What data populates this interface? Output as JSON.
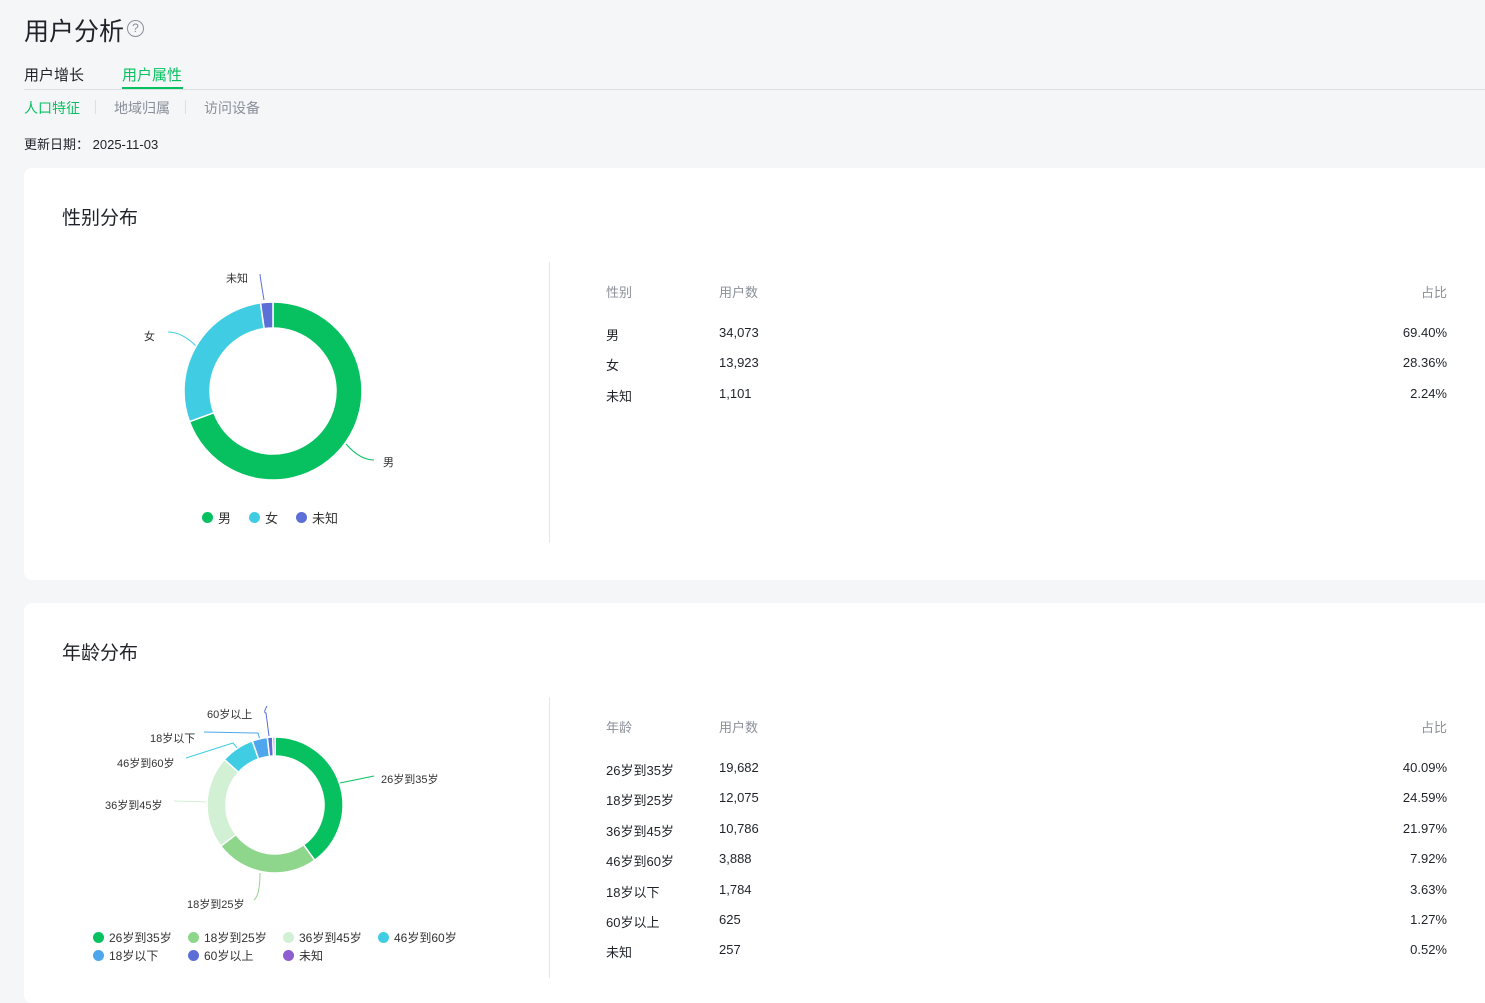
{
  "page": {
    "title": "用户分析",
    "help_icon": "?"
  },
  "tabs": [
    {
      "label": "用户增长"
    },
    {
      "label": "用户属性"
    }
  ],
  "subtabs": [
    {
      "label": "人口特征"
    },
    {
      "label": "地域归属"
    },
    {
      "label": "访问设备"
    }
  ],
  "update": {
    "label": "更新日期：",
    "date": "2025-11-03"
  },
  "gender": {
    "title": "性别分布",
    "headers": [
      "性别",
      "用户数",
      "占比"
    ],
    "rows": [
      {
        "name": "男",
        "count": "34,073",
        "pct": "69.40%",
        "value": 34073,
        "color": "#07c160"
      },
      {
        "name": "女",
        "count": "13,923",
        "pct": "28.36%",
        "value": 13923,
        "color": "#40cde3"
      },
      {
        "name": "未知",
        "count": "1,101",
        "pct": "2.24%",
        "value": 1101,
        "color": "#5b6fd6"
      }
    ]
  },
  "age": {
    "title": "年龄分布",
    "headers": [
      "年龄",
      "用户数",
      "占比"
    ],
    "rows": [
      {
        "name": "26岁到35岁",
        "count": "19,682",
        "pct": "40.09%",
        "value": 19682,
        "color": "#07c160"
      },
      {
        "name": "18岁到25岁",
        "count": "12,075",
        "pct": "24.59%",
        "value": 12075,
        "color": "#8ed68c"
      },
      {
        "name": "36岁到45岁",
        "count": "10,786",
        "pct": "21.97%",
        "value": 10786,
        "color": "#d2f0d4"
      },
      {
        "name": "46岁到60岁",
        "count": "3,888",
        "pct": "7.92%",
        "value": 3888,
        "color": "#40cde3"
      },
      {
        "name": "18岁以下",
        "count": "1,784",
        "pct": "3.63%",
        "value": 1784,
        "color": "#4ea7ec"
      },
      {
        "name": "60岁以上",
        "count": "625",
        "pct": "1.27%",
        "value": 625,
        "color": "#5b6fd6"
      },
      {
        "name": "未知",
        "count": "257",
        "pct": "0.52%",
        "value": 257,
        "color": "#8e5ed0"
      }
    ]
  }
}
